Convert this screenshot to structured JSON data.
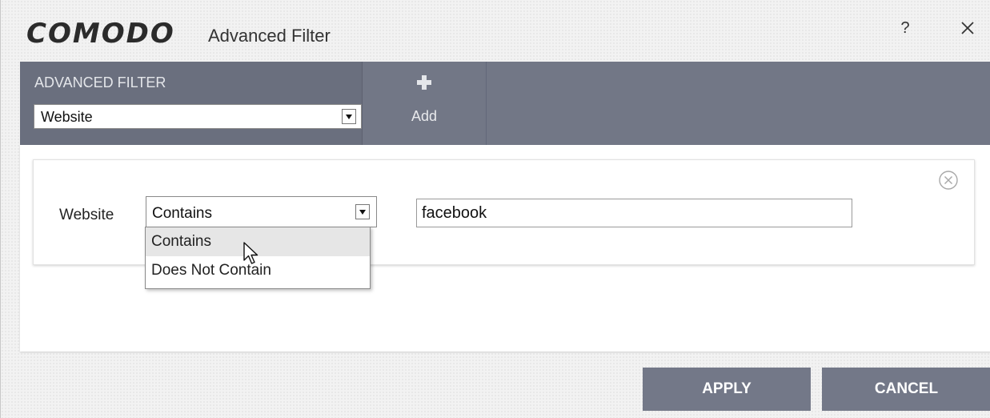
{
  "window": {
    "brand": "COMODO",
    "title": "Advanced Filter",
    "help_label": "?"
  },
  "toolbar": {
    "filter_label": "ADVANCED FILTER",
    "filter_select_value": "Website",
    "add_label": "Add"
  },
  "criteria": {
    "field_label": "Website",
    "condition_value": "Contains",
    "text_value": "facebook"
  },
  "dropdown": {
    "options": [
      "Contains",
      "Does Not Contain"
    ],
    "highlighted": "Contains"
  },
  "footer": {
    "apply_label": "APPLY",
    "cancel_label": "CANCEL"
  },
  "colors": {
    "toolbar": "#727786",
    "button": "#737888"
  },
  "icons": {
    "help": "question-mark",
    "close": "x-mark",
    "add": "plus",
    "remove": "circled-x",
    "dropdown": "triangle-down",
    "cursor": "arrow-pointer"
  }
}
